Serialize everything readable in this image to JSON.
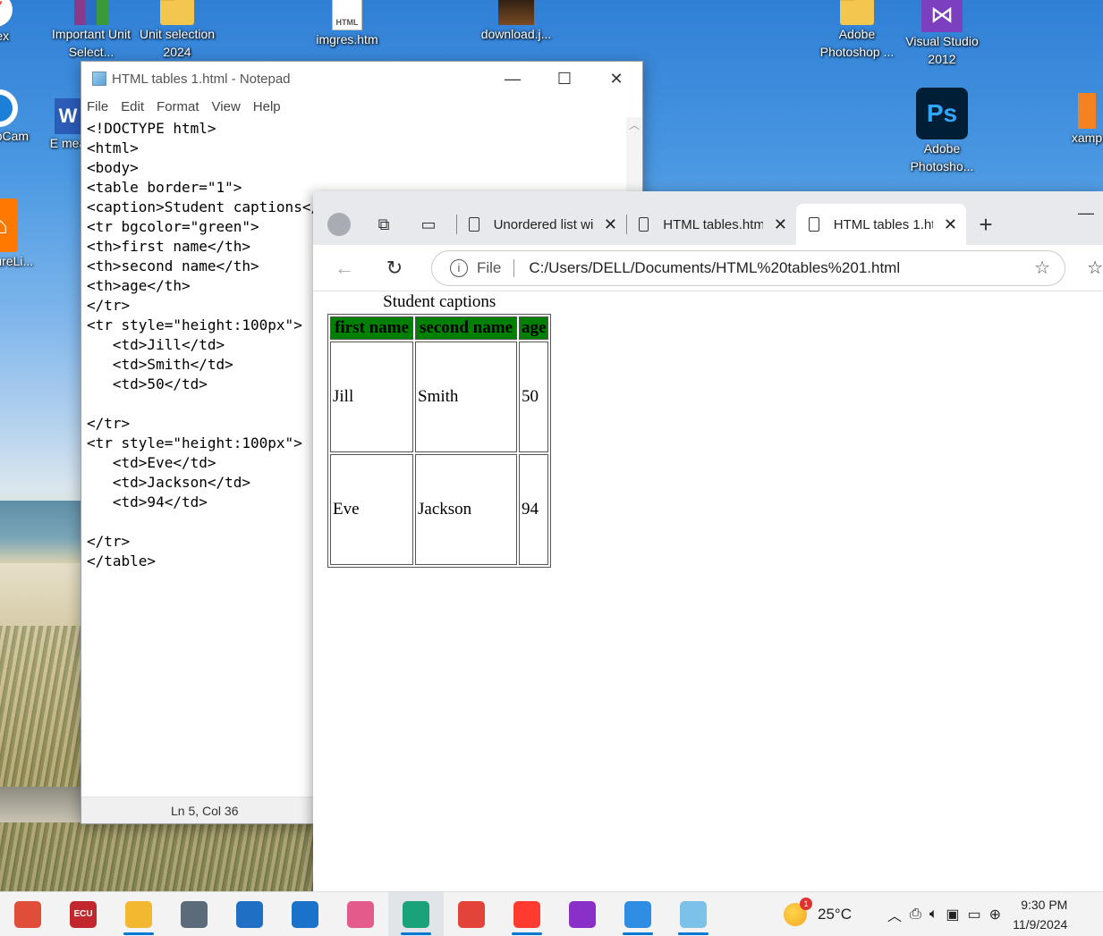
{
  "desktop": {
    "icons": [
      {
        "label": "ndex",
        "icon": "yandex-icon"
      },
      {
        "label": "Important Unit Select...",
        "icon": "winrar-icon"
      },
      {
        "label": "Unit selection 2024",
        "icon": "folder-icon"
      },
      {
        "label": "imgres.htm",
        "icon": "html-file-icon",
        "badge": "HTML"
      },
      {
        "label": "download.j...",
        "icon": "image-file-icon"
      },
      {
        "label": "Adobe Photoshop ...",
        "icon": "folder-icon"
      },
      {
        "label": "Visual Studio 2012",
        "icon": "visual-studio-icon"
      },
      {
        "label": "lock bCam",
        "icon": "webcam-icon"
      },
      {
        "label": "E mea",
        "icon": "word-icon"
      },
      {
        "label": "Adobe Photosho...",
        "icon": "photoshop-icon",
        "glyph": "Ps"
      },
      {
        "label": "xamp",
        "icon": "xampp-icon"
      },
      {
        "label": "vast ureLi...",
        "icon": "avast-icon"
      }
    ]
  },
  "notepad": {
    "title": "HTML tables 1.html - Notepad",
    "menu": [
      "File",
      "Edit",
      "Format",
      "View",
      "Help"
    ],
    "lines": [
      "<!DOCTYPE html>",
      "<html>",
      "<body>",
      "<table border=\"1\">",
      "<caption>Student captions</caption>",
      "<tr bgcolor=\"green\">",
      "<th>first name</th>",
      "<th>second name</th>",
      "<th>age</th>",
      "</tr>",
      "<tr style=\"height:100px\">",
      "   <td>Jill</td>",
      "   <td>Smith</td>",
      "   <td>50</td>",
      "",
      "</tr>",
      "<tr style=\"height:100px\">",
      "   <td>Eve</td>",
      "   <td>Jackson</td>",
      "   <td>94</td>",
      "",
      "</tr>",
      "</table>"
    ],
    "status": "Ln 5, Col 36"
  },
  "browser": {
    "tabs": [
      {
        "label": "Unordered list wi",
        "active": false
      },
      {
        "label": "HTML tables.html",
        "active": false
      },
      {
        "label": "HTML tables 1.ht",
        "active": true
      }
    ],
    "address": {
      "scheme_label": "File",
      "url": "C:/Users/DELL/Documents/HTML%20tables%201.html"
    },
    "page": {
      "caption": "Student captions",
      "header_bg": "#008000",
      "headers": [
        "first name",
        "second name",
        "age"
      ],
      "rows": [
        [
          "Jill",
          "Smith",
          "50"
        ],
        [
          "Eve",
          "Jackson",
          "94"
        ]
      ]
    }
  },
  "taskbar": {
    "apps": [
      {
        "name": "settings-app",
        "color": "#e04e39"
      },
      {
        "name": "ecu-website-app",
        "color": "#c0282d",
        "label": "ECU"
      },
      {
        "name": "file-explorer-app",
        "color": "#f2b830",
        "running": true
      },
      {
        "name": "calculator-app",
        "color": "#5c6b7a"
      },
      {
        "name": "mail-app",
        "color": "#1f6fc5"
      },
      {
        "name": "azure-app",
        "color": "#1a73c9"
      },
      {
        "name": "paint-app",
        "color": "#e45a8a"
      },
      {
        "name": "edge-app",
        "color": "#1aa37a",
        "running": true,
        "active": true
      },
      {
        "name": "chrome-app",
        "color": "#e2443a"
      },
      {
        "name": "yandex-app",
        "color": "#ff3b30",
        "running": true
      },
      {
        "name": "anime-app",
        "color": "#8b2fc9"
      },
      {
        "name": "photos-app",
        "color": "#2f8de4",
        "running": true
      },
      {
        "name": "notepad-app",
        "color": "#7cc1e8",
        "running": true
      }
    ],
    "weather": {
      "temp": "25°C",
      "badge": "1"
    },
    "clock": {
      "time": "9:30 PM",
      "date": "11/9/2024"
    }
  }
}
